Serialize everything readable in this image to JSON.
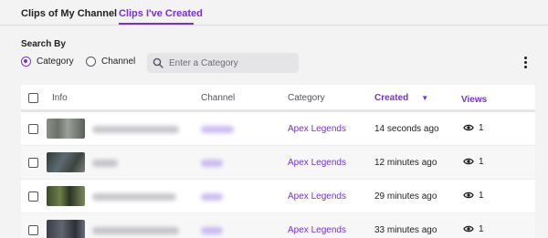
{
  "tabs": [
    {
      "label": "Clips of My Channel"
    },
    {
      "label": "Clips I've Created",
      "active": true
    }
  ],
  "search": {
    "heading": "Search By",
    "options": [
      "Category",
      "Channel"
    ],
    "selected": "Category",
    "placeholder": "Enter a Category"
  },
  "table": {
    "headers": {
      "info": "Info",
      "channel": "Channel",
      "category": "Category",
      "created": "Created",
      "views": "Views"
    },
    "sort": {
      "column": "Created",
      "direction": "descending",
      "icon": "chevron-down-icon"
    },
    "rows": [
      {
        "category": "Apex Legends",
        "created": "14 seconds ago",
        "views": "1"
      },
      {
        "category": "Apex Legends",
        "created": "12 minutes ago",
        "views": "1"
      },
      {
        "category": "Apex Legends",
        "created": "29 minutes ago",
        "views": "1"
      },
      {
        "category": "Apex Legends",
        "created": "33 minutes ago",
        "views": "1"
      }
    ]
  },
  "colors": {
    "accent": "#772ce8",
    "text": "#1f1f23",
    "muted": "#53535f",
    "background": "#f3f3f4"
  }
}
